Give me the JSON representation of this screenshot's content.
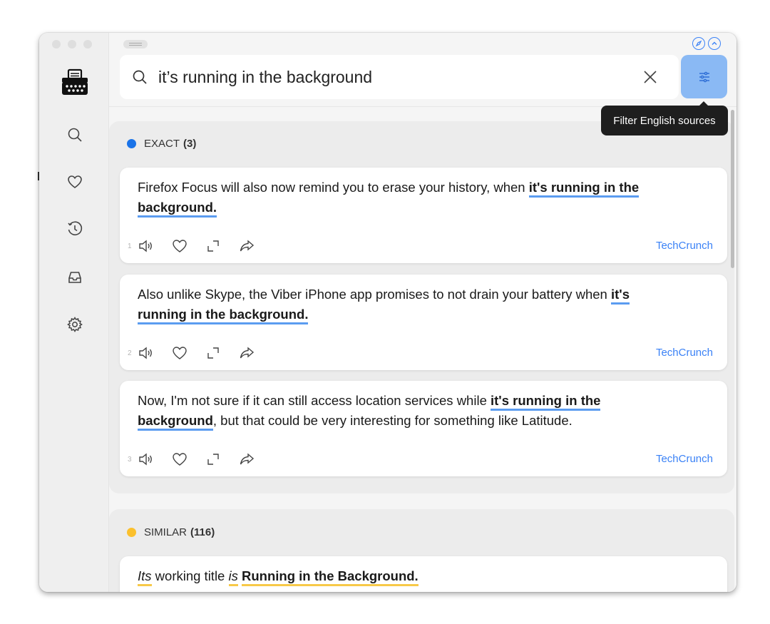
{
  "search": {
    "query": "it’s running in the background",
    "placeholder": ""
  },
  "tooltip": {
    "text": "Filter English sources"
  },
  "sections": {
    "exact": {
      "label": "EXACT",
      "count": "(3)",
      "color": "#1a73e8",
      "results": [
        {
          "number": "1",
          "parts": [
            "Firefox Focus will also now remind you to erase your history, when ",
            "it's running in the background."
          ],
          "source": "TechCrunch"
        },
        {
          "number": "2",
          "parts": [
            "Also unlike Skype, the Viber iPhone app promises to not drain your battery when ",
            "it's running in the background."
          ],
          "source": "TechCrunch"
        },
        {
          "number": "3",
          "parts": [
            "Now, I'm not sure if it can still access location services while ",
            "it's running in the background",
            ", but that could be very interesting for something like Latitude."
          ],
          "source": "TechCrunch"
        }
      ]
    },
    "similar": {
      "label": "SIMILAR",
      "count": "(116)",
      "color": "#fbc02d",
      "results": [
        {
          "parts": [
            "Its",
            " working title ",
            "is",
            " ",
            "Running in the Background."
          ]
        }
      ]
    }
  },
  "colors": {
    "accent": "#3b82f6",
    "filter_button": "#8ab9f4",
    "exact_highlight": "#5b9cf0",
    "similar_highlight": "#f7c948"
  }
}
